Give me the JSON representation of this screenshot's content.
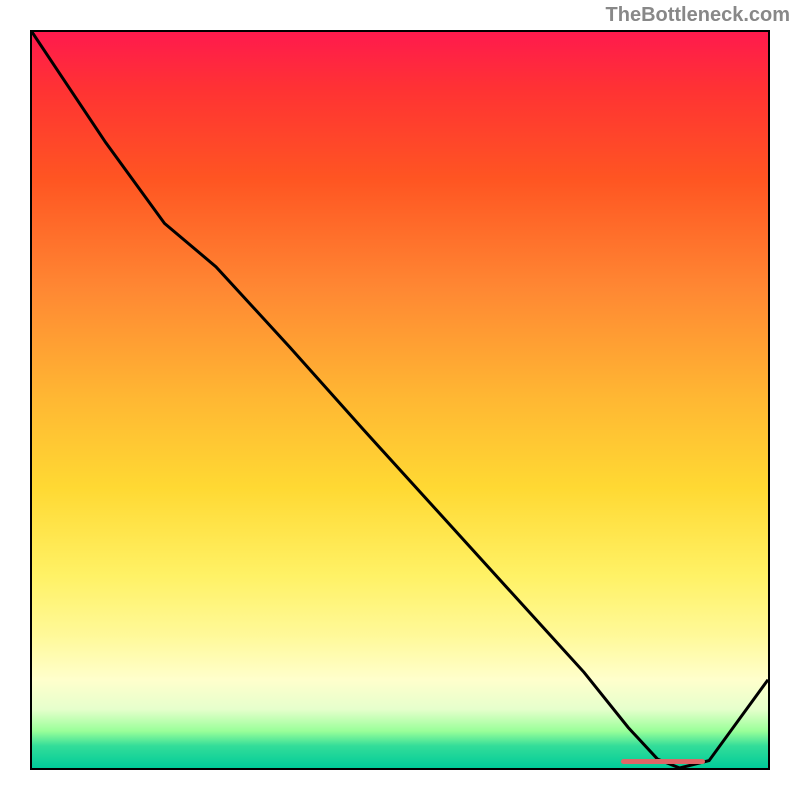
{
  "attribution": "TheBottleneck.com",
  "chart_data": {
    "type": "line",
    "title": "",
    "xlabel": "",
    "ylabel": "",
    "curve": {
      "x": [
        0.0,
        0.04,
        0.1,
        0.18,
        0.25,
        0.35,
        0.45,
        0.55,
        0.65,
        0.75,
        0.81,
        0.85,
        0.88,
        0.92,
        1.0
      ],
      "y": [
        1.0,
        0.94,
        0.85,
        0.74,
        0.681,
        0.572,
        0.46,
        0.35,
        0.24,
        0.13,
        0.055,
        0.012,
        0.0,
        0.01,
        0.12
      ]
    },
    "marker": {
      "x_start": 0.8,
      "x_end": 0.915,
      "y": 0.005
    },
    "xlim": [
      0,
      1
    ],
    "ylim": [
      0,
      1
    ]
  }
}
